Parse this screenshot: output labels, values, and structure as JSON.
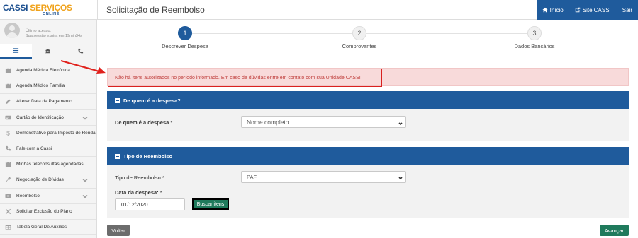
{
  "brand": {
    "name_part1": "CASSI",
    "name_part2": "SERVIÇOS",
    "name_sub": "ONLINE"
  },
  "page_title": "Solicitação de Reembolso",
  "topnav": {
    "home": "Início",
    "site": "Site CASSI",
    "logout": "Sair"
  },
  "user": {
    "last_access": "Último acesso:",
    "session": "Sua sessão expira em 19min34s"
  },
  "sidebar_items": [
    {
      "label": "Agenda Médica Eletrônica",
      "icon": "calendar-icon",
      "chevron": false
    },
    {
      "label": "Agenda Médico Família",
      "icon": "calendar-icon",
      "chevron": false
    },
    {
      "label": "Alterar Data de Pagamento",
      "icon": "edit-icon",
      "chevron": false
    },
    {
      "label": "Cartão de Identificação",
      "icon": "card-icon",
      "chevron": true
    },
    {
      "label": "Demonstrativo para Imposto de Renda",
      "icon": "dollar-icon",
      "chevron": false
    },
    {
      "label": "Fale com a Cassi",
      "icon": "phone-icon",
      "chevron": false
    },
    {
      "label": "Minhas teleconsultas agendadas",
      "icon": "calendar-icon",
      "chevron": false
    },
    {
      "label": "Negociação de Dívidas",
      "icon": "wrench-icon",
      "chevron": true
    },
    {
      "label": "Reembolso",
      "icon": "video-icon",
      "chevron": true
    },
    {
      "label": "Solicitar Exclusão do Plano",
      "icon": "close-icon",
      "chevron": false
    },
    {
      "label": "Tabela Geral De Auxílios",
      "icon": "table-icon",
      "chevron": false
    }
  ],
  "steps": [
    {
      "number": "1",
      "label": "Descrever Despesa",
      "active": true
    },
    {
      "number": "2",
      "label": "Comprovantes",
      "active": false
    },
    {
      "number": "3",
      "label": "Dados Bancários",
      "active": false
    }
  ],
  "alert": "Não há itens autorizados no período informado. Em caso de dúvidas entre em contato com sua Unidade CASSI",
  "panel1": {
    "title": "De quem é a despesa?",
    "field_label": "De quem é a despesa",
    "required": "*",
    "select_value": "Nome completo"
  },
  "panel2": {
    "title": "Tipo de Reembolso",
    "type_label": "Tipo de Reembolso",
    "type_value": "PAF",
    "date_label": "Data da despesa:",
    "date_value": "01/12/2020",
    "search_button": "Buscar itens",
    "required": "*"
  },
  "footer": {
    "back": "Voltar",
    "next": "Avançar"
  },
  "colors": {
    "primary": "#1f5b9c",
    "success": "#1f7a5c",
    "alert_bg": "#f8dada",
    "alert_border": "#d9201f"
  }
}
